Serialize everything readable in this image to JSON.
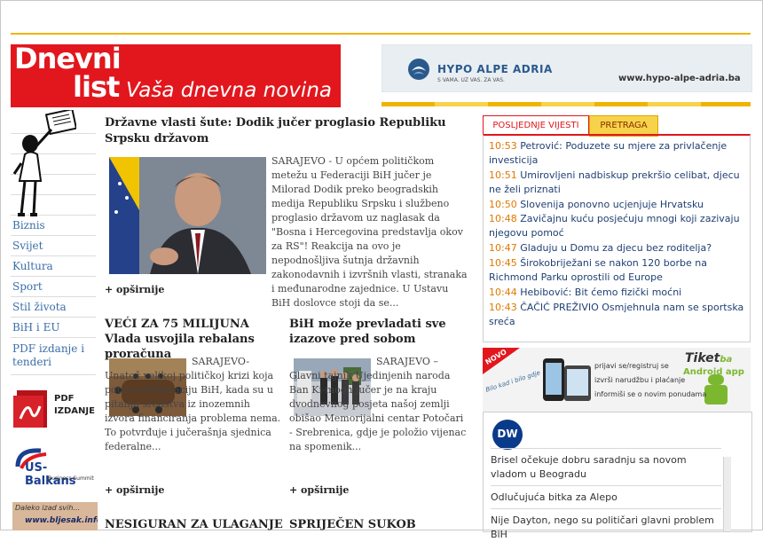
{
  "logo": {
    "line1": "Dnevni",
    "line2": "list",
    "tagline": "Vaša dnevna novina"
  },
  "ad_hypo": {
    "name": "HYPO ALPE ADRIA",
    "slogan": "S VAMA. UZ VAS. ZA VAS.",
    "url": "www.hypo-alpe-adria.ba"
  },
  "nav": {
    "items": [
      {
        "label": "Biznis"
      },
      {
        "label": "Svijet"
      },
      {
        "label": "Kultura"
      },
      {
        "label": "Sport"
      },
      {
        "label": "Stil života"
      },
      {
        "label": "BiH i EU"
      },
      {
        "label": "PDF izdanje i tenderi"
      }
    ]
  },
  "pdf_ad": {
    "line1": "PDF",
    "line2": "IZDANJE"
  },
  "usb_ad": {
    "name": "US-Balkans",
    "sub": "Business Summit"
  },
  "daleko_ad": {
    "text": "Daleko izad svih...",
    "url": "www.bljesak.info"
  },
  "lead": {
    "title": "Državne vlasti šute: Dodik jučer proglasio Republiku Srpsku državom",
    "text": "SARAJEVO - U općem političkom metežu u Federaciji BiH jučer je Milorad Dodik preko beogradskih medija Republiku Srpsku i službeno proglasio državom uz naglasak da \"Bosna i Hercegovina predstavlja okov za RS\"! Reakcija na ovo je nepodnošljiva šutnja državnih zakonodavnih i izvršnih vlasti, stranaka i međunarodne zajednice. U Ustavu BiH doslovce stoji da se...",
    "more": "+ opširnije"
  },
  "article2": {
    "title": "VEĆI ZA 75 MILIJUNA Vlada usvojila rebalans proračuna",
    "text": "SARAJEVO- Unatoč velikoj političkoj krizi koja potresa Federaciju BiH, kada su u pitanju sredstva iz inozemnih izvora financiranja problema nema. To potvrđuje i jučerašnja sjednica federalne...",
    "more": "+ opširnije"
  },
  "article3": {
    "title": "BiH može prevladati sve izazove pred sobom",
    "text": "SARAJEVO – Glavni tajnik Ujedinjenih naroda Ban Ki-moon jučer je na kraju dvodnevnog posjeta našoj zemlji obišao Memorijalni centar Potočari - Srebrenica, gdje je položio vijenac na spomenik...",
    "more": "+ opširnije"
  },
  "bottom": {
    "left": "NESIGURAN ZA ULAGANJE",
    "right": "SPRIJEČEN SUKOB"
  },
  "tabs": {
    "latest": "POSLJEDNJE VIJESTI",
    "search": "PRETRAGA"
  },
  "latest_news": [
    {
      "time": "10:53",
      "text": "Petrović: Poduzete su mjere za privlačenje investicija"
    },
    {
      "time": "10:51",
      "text": "Umirovljeni nadbiskup prekršio celibat, djecu ne želi priznati"
    },
    {
      "time": "10:50",
      "text": "Slovenija ponovno ucjenjuje Hrvatsku"
    },
    {
      "time": "10:48",
      "text": "Zavičajnu kuću posjećuju mnogi koji zazivaju njegovu pomoć"
    },
    {
      "time": "10:47",
      "text": "Gladuju u Domu za djecu bez roditelja?"
    },
    {
      "time": "10:45",
      "text": "Širokobriježani se nakon 120 borbe na Richmond Parku oprostili od Europe"
    },
    {
      "time": "10:44",
      "text": "Hebibović: Bit ćemo fizički moćni"
    },
    {
      "time": "10:43",
      "text": "ČAČIĆ PREŽIVIO Osmjehnula nam se sportska sreća"
    }
  ],
  "tiket_ad": {
    "badge": "NOVO",
    "slogan": "Bilo kad i bilo gdje",
    "brand": "Tiket",
    "brand2": "ba",
    "app": "Android app",
    "bullets": [
      "prijavi se/registruj se",
      "izvrši narudžbu i plaćanje",
      "informiši se o novim ponudama"
    ]
  },
  "dw": {
    "logo": "DW",
    "items": [
      "Brisel očekuje dobru saradnju sa novom vladom u Beogradu",
      "Odlučujuća bitka za Alepo",
      "Nije Dayton, nego su političari glavni problem BiH"
    ]
  },
  "colors": {
    "brand_red": "#e2171d",
    "accent_yellow": "#f0b400",
    "link_blue": "#3b6ea8",
    "time_orange": "#e07800"
  }
}
